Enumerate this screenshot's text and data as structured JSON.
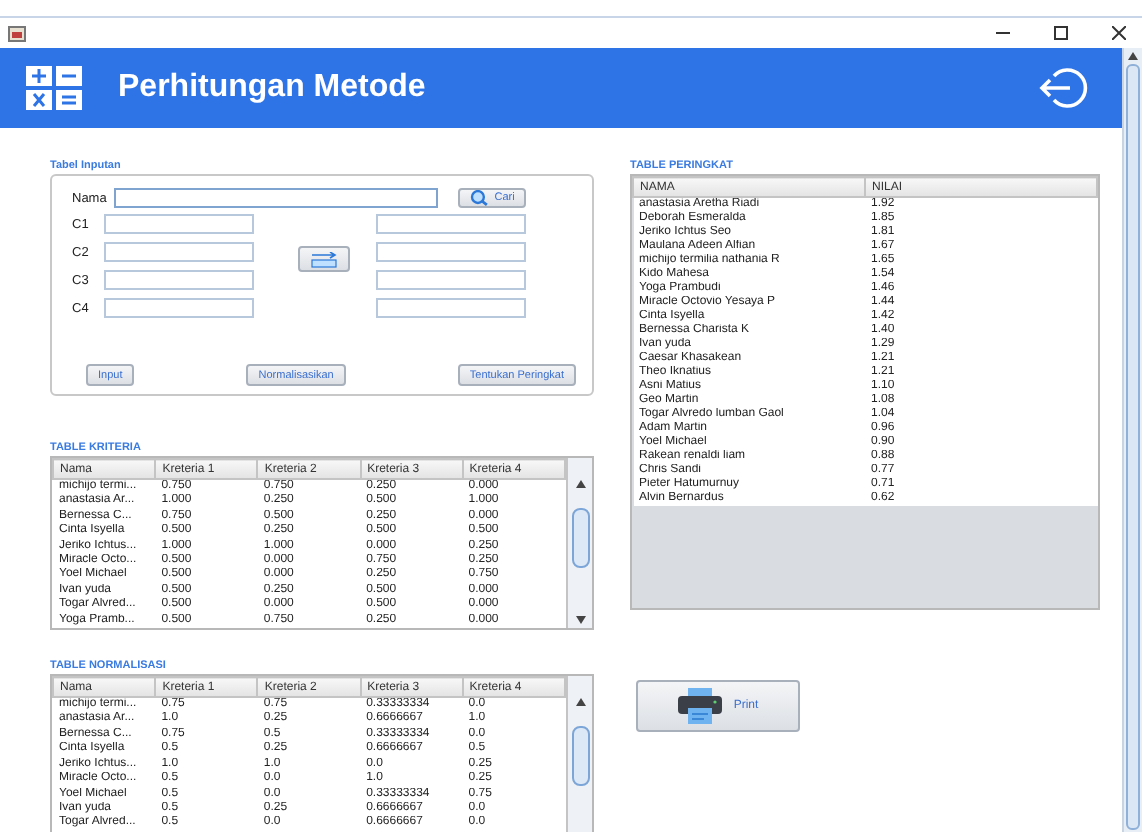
{
  "header": {
    "title": "Perhitungan Metode"
  },
  "input_panel": {
    "title": "Tabel Inputan",
    "name_label": "Nama",
    "search_button": "Cari",
    "criteria": [
      {
        "label": "C1"
      },
      {
        "label": "C2"
      },
      {
        "label": "C3"
      },
      {
        "label": "C4"
      }
    ],
    "buttons": [
      "Input",
      "Normalisasikan",
      "Tentukan Peringkat"
    ]
  },
  "kriteria_table": {
    "title": "TABLE KRITERIA",
    "columns": [
      "Nama",
      "Kreteria 1",
      "Kreteria 2",
      "Kreteria 3",
      "Kreteria 4"
    ],
    "rows": [
      [
        "michijo termi...",
        "0.750",
        "0.750",
        "0.250",
        "0.000"
      ],
      [
        "anastasia Ar...",
        "1.000",
        "0.250",
        "0.500",
        "1.000"
      ],
      [
        "Bernessa C...",
        "0.750",
        "0.500",
        "0.250",
        "0.000"
      ],
      [
        "Cinta Isyella",
        "0.500",
        "0.250",
        "0.500",
        "0.500"
      ],
      [
        "Jeriko Ichtus...",
        "1.000",
        "1.000",
        "0.000",
        "0.250"
      ],
      [
        "Miracle Octo...",
        "0.500",
        "0.000",
        "0.750",
        "0.250"
      ],
      [
        "Yoel Michael",
        "0.500",
        "0.000",
        "0.250",
        "0.750"
      ],
      [
        "Ivan yuda",
        "0.500",
        "0.250",
        "0.500",
        "0.000"
      ],
      [
        "Togar Alvred...",
        "0.500",
        "0.000",
        "0.500",
        "0.000"
      ],
      [
        "Yoga Pramb...",
        "0.500",
        "0.750",
        "0.250",
        "0.000"
      ]
    ]
  },
  "normalisasi_table": {
    "title": "TABLE NORMALISASI",
    "columns": [
      "Nama",
      "Kreteria 1",
      "Kreteria 2",
      "Kreteria 3",
      "Kreteria 4"
    ],
    "rows": [
      [
        "michijo termi...",
        "0.75",
        "0.75",
        "0.33333334",
        "0.0"
      ],
      [
        "anastasia Ar...",
        "1.0",
        "0.25",
        "0.6666667",
        "1.0"
      ],
      [
        "Bernessa C...",
        "0.75",
        "0.5",
        "0.33333334",
        "0.0"
      ],
      [
        "Cinta Isyella",
        "0.5",
        "0.25",
        "0.6666667",
        "0.5"
      ],
      [
        "Jeriko Ichtus...",
        "1.0",
        "1.0",
        "0.0",
        "0.25"
      ],
      [
        "Miracle Octo...",
        "0.5",
        "0.0",
        "1.0",
        "0.25"
      ],
      [
        "Yoel Michael",
        "0.5",
        "0.0",
        "0.33333334",
        "0.75"
      ],
      [
        "Ivan yuda",
        "0.5",
        "0.25",
        "0.6666667",
        "0.0"
      ],
      [
        "Togar Alvred...",
        "0.5",
        "0.0",
        "0.6666667",
        "0.0"
      ]
    ]
  },
  "peringkat_table": {
    "title": "TABLE PERINGKAT",
    "columns": [
      "NAMA",
      "NILAI"
    ],
    "rows": [
      [
        "anastasia Aretha Riadi",
        "1.92"
      ],
      [
        "Deborah Esmeralda",
        "1.85"
      ],
      [
        "Jeriko Ichtus Seo",
        "1.81"
      ],
      [
        "Maulana Adeen Alfian",
        "1.67"
      ],
      [
        "michijo termilia nathania R",
        "1.65"
      ],
      [
        "Kido Mahesa",
        "1.54"
      ],
      [
        "Yoga Prambudi",
        "1.46"
      ],
      [
        "Miracle Octovio Yesaya P",
        "1.44"
      ],
      [
        "Cinta Isyella",
        "1.42"
      ],
      [
        "Bernessa Charista K",
        "1.40"
      ],
      [
        "Ivan yuda",
        "1.29"
      ],
      [
        "Caesar Khasakean",
        "1.21"
      ],
      [
        "Theo Iknatius",
        "1.21"
      ],
      [
        "Asni Matius",
        "1.10"
      ],
      [
        "Geo Martin",
        "1.08"
      ],
      [
        "Togar Alvredo lumban Gaol",
        "1.04"
      ],
      [
        "Adam Martin",
        "0.96"
      ],
      [
        "Yoel Michael",
        "0.90"
      ],
      [
        "Rakean renaldi liam",
        "0.88"
      ],
      [
        "Chris Sandi",
        "0.77"
      ],
      [
        "Pieter Hatumurnuy",
        "0.71"
      ],
      [
        "Alvin Bernardus",
        "0.62"
      ]
    ]
  },
  "print_button": {
    "label": "Print"
  }
}
